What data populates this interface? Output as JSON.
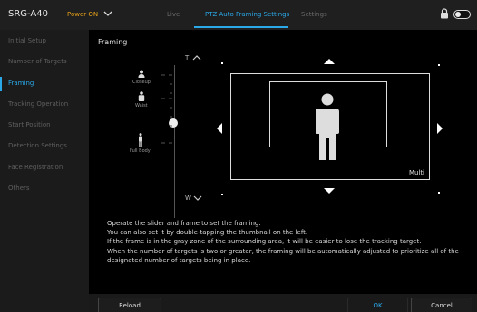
{
  "header": {
    "model": "SRG-A40",
    "power_status": "Power ON",
    "power_color": "#e8a21a",
    "tabs": [
      {
        "label": "Live"
      },
      {
        "label": "PTZ Auto Framing Settings"
      },
      {
        "label": "Settings"
      }
    ],
    "active_tab": 1,
    "accent_color": "#2aa8e8"
  },
  "sidebar": {
    "items": [
      {
        "label": "Initial Setup"
      },
      {
        "label": "Number of Targets"
      },
      {
        "label": "Framing"
      },
      {
        "label": "Tracking Operation"
      },
      {
        "label": "Start Position"
      },
      {
        "label": "Detection Settings"
      },
      {
        "label": "Face Registration"
      },
      {
        "label": "Others"
      }
    ],
    "active_index": 2
  },
  "main": {
    "title": "Framing",
    "slider": {
      "top_label": "T",
      "bottom_label": "W",
      "presets": [
        {
          "label": "Closeup",
          "icon": "person-closeup-icon"
        },
        {
          "label": "Waist",
          "icon": "person-waist-icon"
        },
        {
          "label": "Full Body",
          "icon": "person-fullbody-icon"
        }
      ]
    },
    "preview": {
      "mode_label": "Multi"
    },
    "instructions": [
      "Operate the slider and frame to set the framing.",
      "You can also set it by double-tapping the thumbnail on the left.",
      "If the frame is in the gray zone of the surrounding area, it will be easier to lose the tracking target.",
      "When the number of targets is two or greater, the framing will be automatically adjusted to prioritize all of the",
      "designated number of targets being in place."
    ]
  },
  "footer": {
    "reload_label": "Reload",
    "ok_label": "OK",
    "cancel_label": "Cancel"
  }
}
